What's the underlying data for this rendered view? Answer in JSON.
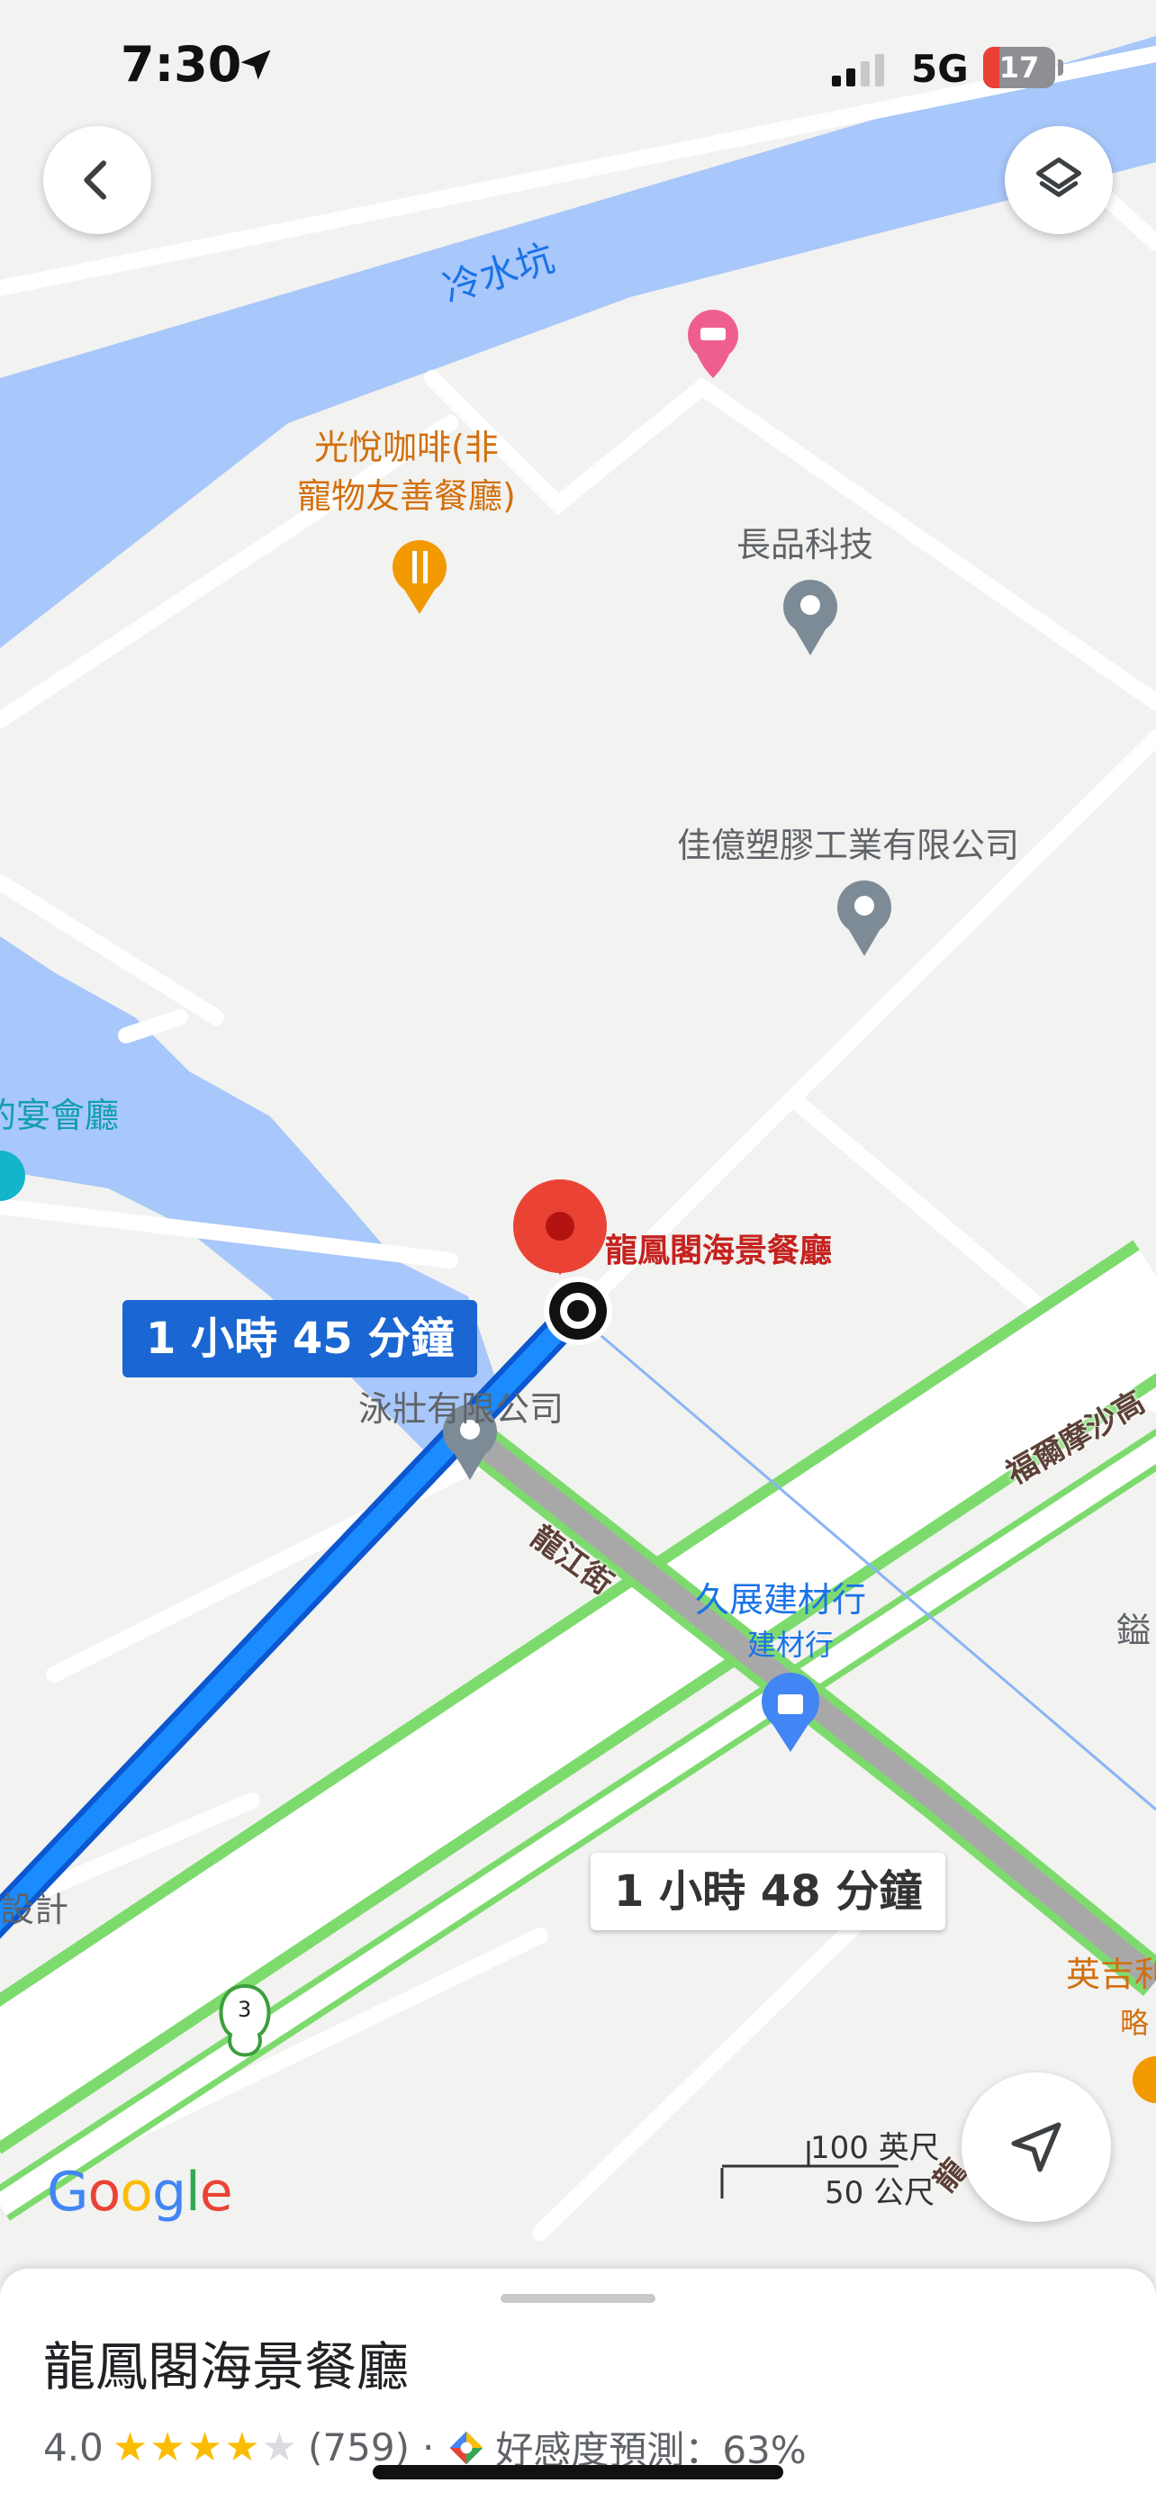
{
  "status_bar": {
    "time": "7:30",
    "network": "5G",
    "battery_level": "17"
  },
  "map": {
    "labels": {
      "river": "冷水坑",
      "cafe": "光悅咖啡(非\n寵物友善餐廳)",
      "company1": "長品科技",
      "company2": "佳億塑膠工業有限公司",
      "banquet": "的宴會廳",
      "destination": "龍鳳閣海景餐廳",
      "company3": "泳壯有限公司",
      "street": "龍江街",
      "store": "久展建材行",
      "store_sub": "建材行",
      "highway": "福爾摩沙高",
      "edge_right": "鎰",
      "design": "設計",
      "edge_bottom1": "英吉利",
      "edge_bottom2": "略",
      "road_bottom": "龍",
      "route_shield": "3"
    },
    "eta_primary": "1 小時 45 分鐘",
    "eta_alt": "1 小時 48 分鐘",
    "scale_imperial": "100 英尺",
    "scale_metric": "50 公尺",
    "logo": "Google"
  },
  "place_sheet": {
    "name": "龍鳳閣海景餐廳",
    "rating": "4.0",
    "stars_filled": 4,
    "review_count": "(759)",
    "separator": "·",
    "vibe_text": "好感度預測：63%"
  },
  "colors": {
    "water": "#a8c7fa",
    "route_primary": "#1a73e8",
    "highway": "#7ddb6e",
    "accent_red": "#ea4335"
  }
}
